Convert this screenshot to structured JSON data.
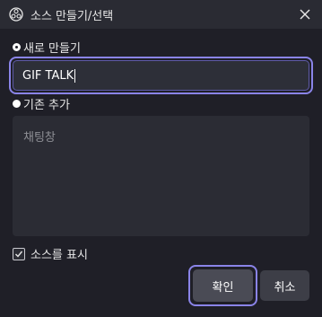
{
  "window": {
    "title": "소스 만들기/선택",
    "icon": "obs-logo-icon"
  },
  "create_new": {
    "label": "새로 만들기",
    "selected": true,
    "name_value": "GIF TALK"
  },
  "add_existing": {
    "label": "기존 추가",
    "selected": false,
    "items": [
      "채팅창"
    ]
  },
  "visibility": {
    "label": "소스를 표시",
    "checked": true
  },
  "buttons": {
    "ok": "확인",
    "cancel": "취소"
  },
  "colors": {
    "accent_highlight": "#8a84e8",
    "background": "#1f1f27",
    "titlebar": "#2a2b33"
  }
}
